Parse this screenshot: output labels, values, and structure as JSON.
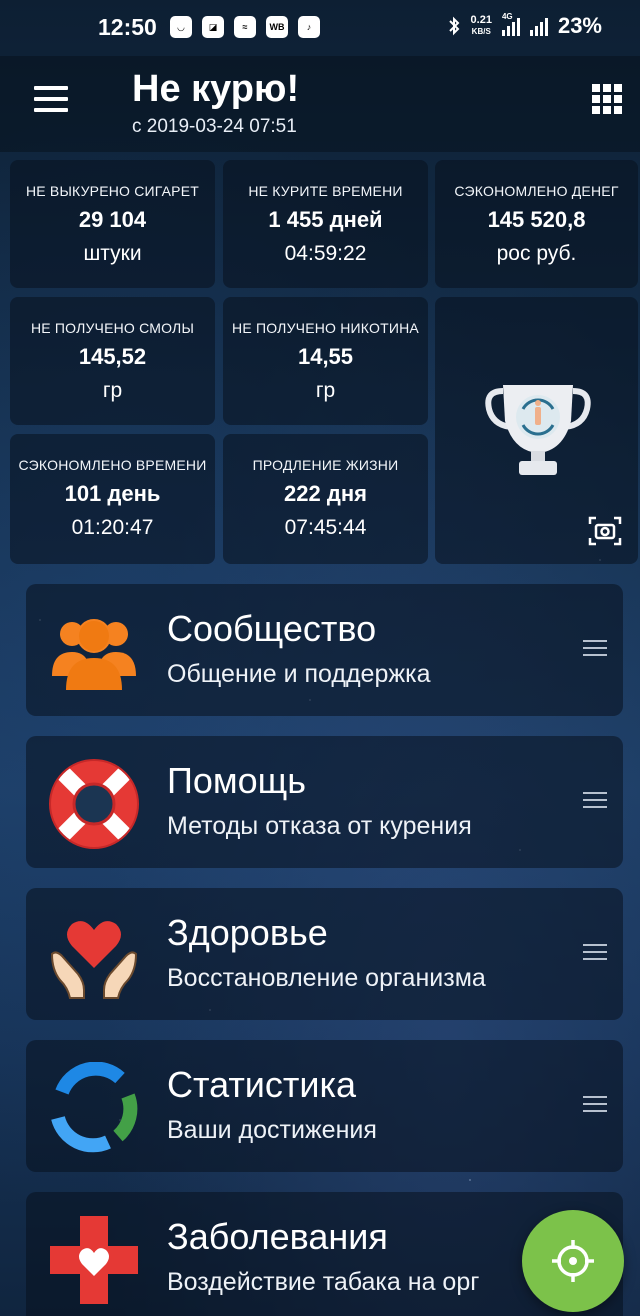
{
  "status_bar": {
    "time": "12:50",
    "app_icons": [
      "app-icon",
      "app-icon",
      "app-icon",
      "WB",
      "app-icon"
    ],
    "speed_value": "0.21",
    "speed_unit": "KB/S",
    "network": "4G",
    "battery": "23%"
  },
  "header": {
    "title": "Не курю!",
    "subtitle": "с 2019-03-24 07:51",
    "menu_icon": "hamburger-menu-icon",
    "grid_icon": "grid-apps-icon"
  },
  "stats": [
    {
      "label": "НЕ ВЫКУРЕНО СИГАРЕТ",
      "value": "29 104",
      "sub": "штуки"
    },
    {
      "label": "НЕ КУРИТЕ ВРЕМЕНИ",
      "value": "1 455 дней",
      "sub": "04:59:22"
    },
    {
      "label": "СЭКОНОМЛЕНО ДЕНЕГ",
      "value": "145 520,8",
      "sub": "рос руб."
    },
    {
      "label": "НЕ ПОЛУЧЕНО СМОЛЫ",
      "value": "145,52",
      "sub": "гр"
    },
    {
      "label": "НЕ ПОЛУЧЕНО НИКОТИНА",
      "value": "14,55",
      "sub": "гр"
    },
    {
      "label": "СЭКОНОМЛЕНО ВРЕМЕНИ",
      "value": "101 день",
      "sub": "01:20:47"
    },
    {
      "label": "ПРОДЛЕНИЕ ЖИЗНИ",
      "value": "222 дня",
      "sub": "07:45:44"
    }
  ],
  "menu": [
    {
      "title": "Сообщество",
      "desc": "Общение и поддержка",
      "icon": "community-icon"
    },
    {
      "title": "Помощь",
      "desc": "Методы отказа от курения",
      "icon": "lifebuoy-icon"
    },
    {
      "title": "Здоровье",
      "desc": "Восстановление организма",
      "icon": "heart-hands-icon"
    },
    {
      "title": "Статистика",
      "desc": "Ваши достижения",
      "icon": "statistics-icon"
    },
    {
      "title": "Заболевания",
      "desc": "Воздействие табака на орг",
      "icon": "medical-cross-icon"
    }
  ],
  "colors": {
    "fab": "#7cc24a",
    "community": "#f58220",
    "lifebuoy": "#e53935",
    "heart": "#e53935",
    "stat_blue": "#1e88e5",
    "stat_green": "#43a047",
    "cross": "#e53935"
  }
}
